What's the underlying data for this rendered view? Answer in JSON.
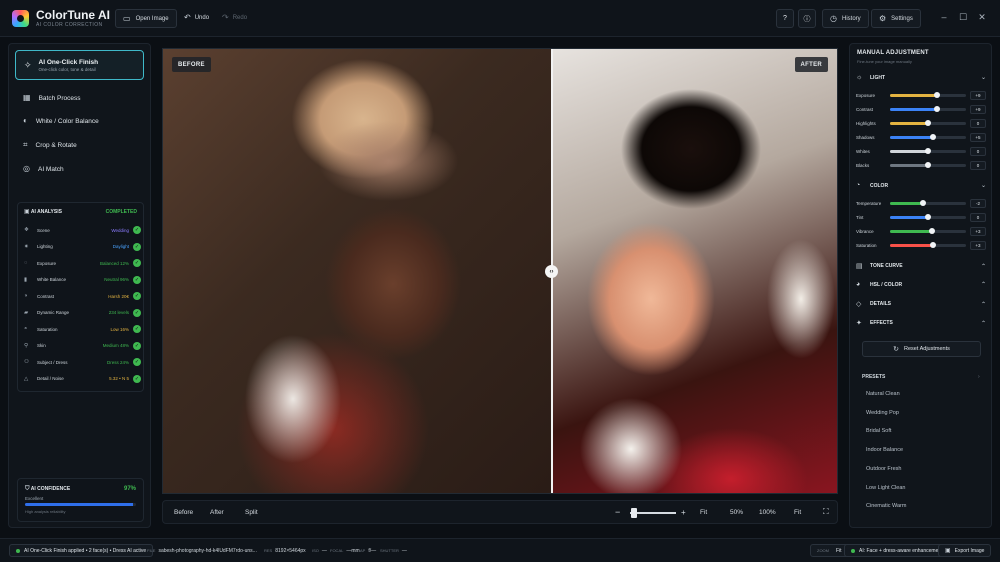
{
  "app": {
    "title": "ColorTune AI",
    "subtitle": "AI COLOR CORRECTION"
  },
  "toolbar": {
    "open_image": "Open Image",
    "undo": "Undo",
    "redo": "Redo",
    "help": "?",
    "info": "ⓘ",
    "history": "History",
    "settings": "Settings"
  },
  "left": {
    "one_click": {
      "title": "AI One-Click Finish",
      "subtitle": "One-click color, tone & detail"
    },
    "nav": [
      "Batch Process",
      "White / Color Balance",
      "Crop & Rotate",
      "AI Match"
    ],
    "analysis": {
      "title": "AI ANALYSIS",
      "status": "COMPLETED",
      "rows": [
        {
          "label": "Scene",
          "value": "Wedding",
          "color": "#8b7cff"
        },
        {
          "label": "Lighting",
          "value": "Daylight",
          "color": "#4aa3ff"
        },
        {
          "label": "Exposure",
          "value": "Balanced 12%",
          "color": "#3fb950"
        },
        {
          "label": "White Balance",
          "value": "Neutral 96%",
          "color": "#3fb950"
        },
        {
          "label": "Contrast",
          "value": "Harsh 20€",
          "color": "#e3b341"
        },
        {
          "label": "Dynamic Range",
          "value": "234 levels",
          "color": "#3fb950"
        },
        {
          "label": "Saturation",
          "value": "Low 16%",
          "color": "#e3b341"
        },
        {
          "label": "Skin",
          "value": "Medium 48%",
          "color": "#3fb950"
        },
        {
          "label": "Subject / Dress",
          "value": "Dress 24%",
          "color": "#3fb950"
        },
        {
          "label": "Detail / Noise",
          "value": "5.32 • N 5",
          "color": "#e3b341"
        }
      ]
    },
    "confidence": {
      "title": "AI CONFIDENCE",
      "value": "97%",
      "fraction": 0.97,
      "label": "Excellent",
      "note": "High analysis reliability"
    }
  },
  "viewer": {
    "before_tag": "BEFORE",
    "after_tag": "AFTER",
    "split_fraction": 0.574
  },
  "viewer_bar": {
    "before": "Before",
    "after": "After",
    "split": "Split",
    "minus": "−",
    "plus": "+",
    "fit1": "Fit",
    "z50": "50%",
    "z100": "100%",
    "fit2": "Fit"
  },
  "right": {
    "title": "MANUAL ADJUSTMENT",
    "subtitle": "Fine-tune your image manually",
    "light": {
      "label": "LIGHT",
      "sliders": [
        {
          "label": "Exposure",
          "value": "+9",
          "fraction": 0.62,
          "color": "#e3b341"
        },
        {
          "label": "Contrast",
          "value": "+9",
          "fraction": 0.62,
          "color": "#3b82f6"
        },
        {
          "label": "Highlights",
          "value": "0",
          "fraction": 0.5,
          "color": "#e3b341"
        },
        {
          "label": "Shadows",
          "value": "+5",
          "fraction": 0.56,
          "color": "#3b82f6"
        },
        {
          "label": "Whites",
          "value": "0",
          "fraction": 0.5,
          "color": "#d0d5da"
        },
        {
          "label": "Blacks",
          "value": "0",
          "fraction": 0.5,
          "color": "#6e7781"
        }
      ]
    },
    "color": {
      "label": "COLOR",
      "sliders": [
        {
          "label": "Temperature",
          "value": "-2",
          "fraction": 0.44,
          "color": "#3fb950"
        },
        {
          "label": "Tint",
          "value": "0",
          "fraction": 0.5,
          "color": "#3b82f6"
        },
        {
          "label": "Vibrance",
          "value": "+3",
          "fraction": 0.55,
          "color": "#3fb950"
        },
        {
          "label": "Saturation",
          "value": "+3",
          "fraction": 0.57,
          "color": "#f85149"
        }
      ]
    },
    "sections": [
      "TONE CURVE",
      "HSL / COLOR",
      "DETAILS",
      "EFFECTS"
    ],
    "reset": "Reset Adjustments",
    "presets_title": "PRESETS",
    "presets": [
      "Natural Clean",
      "Wedding Pop",
      "Bridal Soft",
      "Indoor Balance",
      "Outdoor Fresh",
      "Low Light Clean",
      "Cinematic Warm"
    ]
  },
  "status": {
    "applied": "AI One-Click Finish applied • 2 face(s) • Dress AI active",
    "file_label": "FILE",
    "file": "sabesh-photography-hd-k4lUdFM7rdo-uns...",
    "res_label": "RES",
    "res": "8192×5464px",
    "iso_label": "ISO",
    "iso": "—",
    "focal_label": "FOCAL",
    "focal": "—mm",
    "ap_label": "AP",
    "ap": "f/—",
    "shutter_label": "SHUTTER",
    "shutter": "—",
    "zoom_label": "ZOOM",
    "zoom": "Fit",
    "ai_note": "AI: Face + dress-aware enhancement",
    "export": "Export Image"
  }
}
